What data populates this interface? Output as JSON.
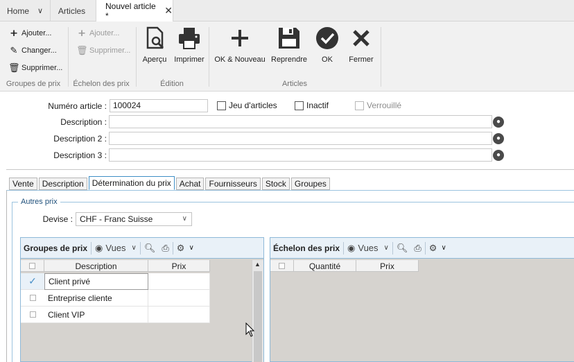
{
  "tabs": {
    "home": "Home",
    "articles": "Articles",
    "active": "Nouvel article *"
  },
  "ribbon": {
    "groupes_de_prix": {
      "name": "Groupes de prix",
      "ajouter": "Ajouter...",
      "changer": "Changer...",
      "supprimer": "Supprimer..."
    },
    "echelon_des_prix": {
      "name": "Échelon des prix",
      "ajouter": "Ajouter...",
      "supprimer": "Supprimer..."
    },
    "edition": {
      "name": "Édition",
      "apercu": "Aperçu",
      "imprimer": "Imprimer"
    },
    "articles": {
      "name": "Articles",
      "ok_nouveau": "OK & Nouveau",
      "reprendre": "Reprendre",
      "ok": "OK",
      "fermer": "Fermer"
    }
  },
  "form": {
    "numero_label": "Numéro article :",
    "numero_value": "100024",
    "jeu_label": "Jeu d'articles",
    "inactif_label": "Inactif",
    "verrouille_label": "Verrouillé",
    "description_label": "Description :",
    "description2_label": "Description 2 :",
    "description3_label": "Description 3 :"
  },
  "subtabs": [
    "Vente",
    "Description",
    "Détermination du prix",
    "Achat",
    "Fournisseurs",
    "Stock",
    "Groupes"
  ],
  "autres_prix": {
    "legend": "Autres prix",
    "devise_label": "Devise :",
    "devise_value": "CHF - Franc Suisse"
  },
  "groupes_grid": {
    "title": "Groupes de prix",
    "vues": "Vues",
    "columns": [
      "Description",
      "Prix"
    ],
    "rows": [
      {
        "description": "Client privé",
        "prix": ""
      },
      {
        "description": "Entreprise cliente",
        "prix": ""
      },
      {
        "description": "Client VIP",
        "prix": ""
      }
    ]
  },
  "echelon_grid": {
    "title": "Échelon des prix",
    "vues": "Vues",
    "columns": [
      "Quantité",
      "Prix"
    ]
  }
}
